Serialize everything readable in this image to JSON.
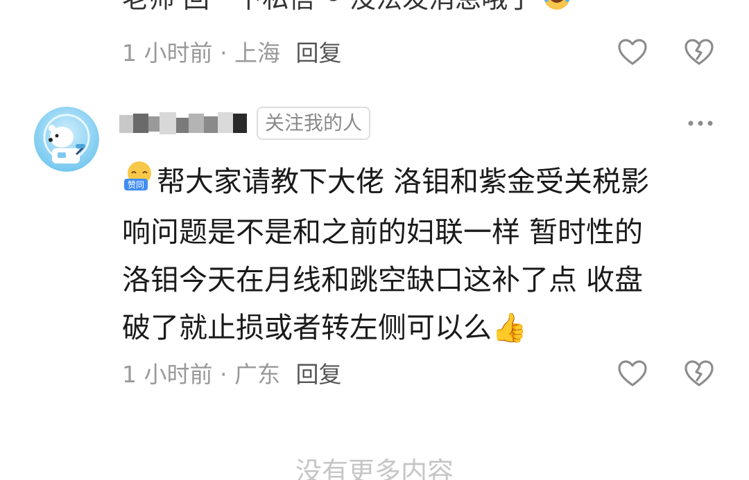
{
  "previous_comment": {
    "text_cut": "老师 回一下私信～ 没法发消息哦了",
    "emoji": "tears-of-joy-emoji",
    "time": "1 小时前",
    "sep": "·",
    "location": "上海",
    "reply": "回复"
  },
  "comment": {
    "avatar": "polar-bear-astronaut-avatar",
    "tag": "关注我的人",
    "badge_text": "赞同",
    "line1": "帮大家请教下大佬 洛钼和紫金受关税影",
    "line2": "响问题是不是和之前的妇联一样 暂时性的",
    "line3": "洛钼今天在月线和跳空缺口这补了点 收盘",
    "line4": "破了就止损或者转左侧可以么",
    "end_emoji": "👍",
    "time": "1 小时前",
    "sep": "·",
    "location": "广东",
    "reply": "回复"
  },
  "footer": {
    "no_more": "没有更多内容"
  },
  "colors": {
    "meta_text": "#999999",
    "body_text": "#1a1a1a",
    "icon_stroke": "#8c8c8c",
    "footer_text": "#c6c6c6"
  }
}
